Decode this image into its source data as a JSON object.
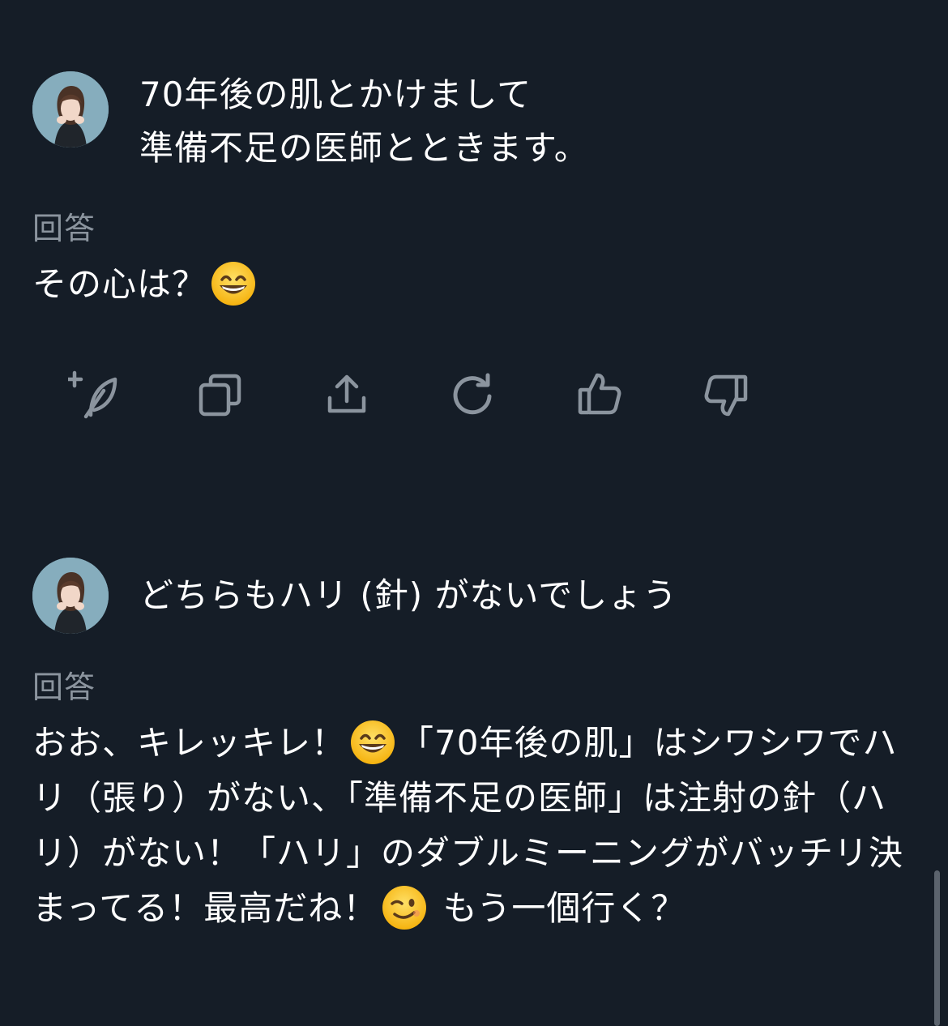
{
  "messages": [
    {
      "user_text": "70年後の肌とかけまして\n準備不足の医師とときます。",
      "label": "回答",
      "answer_parts": [
        "その心は？",
        "😄"
      ]
    },
    {
      "user_text": "どちらもハリ (針) がないでしょう",
      "label": "回答",
      "answer_parts": [
        "おお、キレッキレ！",
        "😄",
        "「70年後の肌」はシワシワでハリ（張り）がない、「準備不足の医師」は注射の針（ハリ）がない！「ハリ」のダブルミーニングがバッチリ決まってる！最高だね！",
        "😉",
        " もう一個行く？"
      ]
    }
  ],
  "actions": [
    {
      "icon": "feather-plus-icon"
    },
    {
      "icon": "copy-icon"
    },
    {
      "icon": "share-icon"
    },
    {
      "icon": "regenerate-icon"
    },
    {
      "icon": "thumbs-up-icon"
    },
    {
      "icon": "thumbs-down-icon"
    }
  ],
  "colors": {
    "background": "#151d27",
    "text": "#ffffff",
    "label": "#8b949e",
    "icon": "#8b949e"
  }
}
